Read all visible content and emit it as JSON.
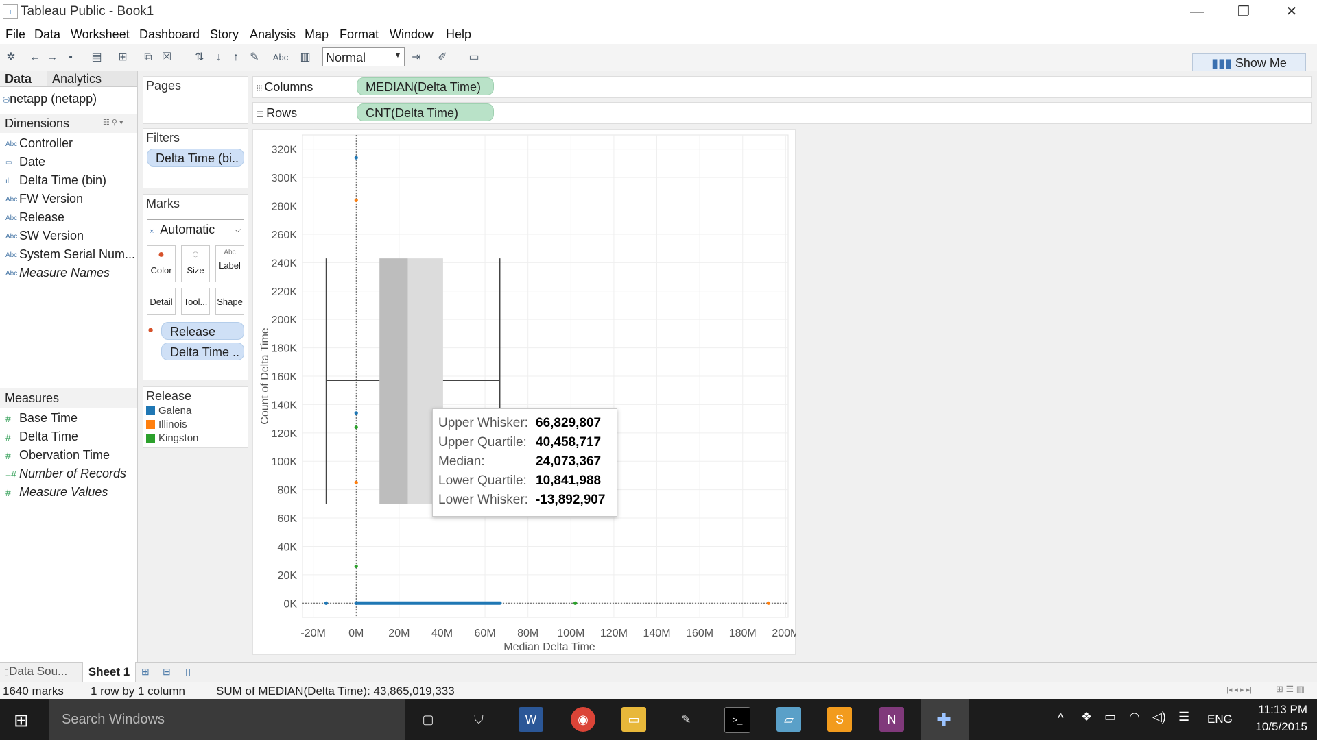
{
  "window": {
    "title": "Tableau Public - Book1",
    "minimize": "—",
    "restore": "❐",
    "close": "✕"
  },
  "menu": [
    "File",
    "Data",
    "Worksheet",
    "Dashboard",
    "Story",
    "Analysis",
    "Map",
    "Format",
    "Window",
    "Help"
  ],
  "toolbar": {
    "mark_size": "Normal",
    "show_me": "Show Me",
    "abc_label": "Abc"
  },
  "data_pane": {
    "tabs": [
      "Data",
      "Analytics"
    ],
    "datasource": "netapp (netapp)",
    "dimensions_header": "Dimensions",
    "dimensions": [
      {
        "icon": "Abc",
        "label": "Controller",
        "italic": false
      },
      {
        "icon": "▭",
        "label": "Date",
        "italic": false
      },
      {
        "icon": "ıl",
        "label": "Delta Time (bin)",
        "italic": false
      },
      {
        "icon": "Abc",
        "label": "FW Version",
        "italic": false
      },
      {
        "icon": "Abc",
        "label": "Release",
        "italic": false
      },
      {
        "icon": "Abc",
        "label": "SW Version",
        "italic": false
      },
      {
        "icon": "Abc",
        "label": "System Serial Num...",
        "italic": false
      },
      {
        "icon": "Abc",
        "label": "Measure Names",
        "italic": true
      }
    ],
    "measures_header": "Measures",
    "measures": [
      {
        "icon": "#",
        "label": "Base Time",
        "italic": false
      },
      {
        "icon": "#",
        "label": "Delta Time",
        "italic": false
      },
      {
        "icon": "#",
        "label": "Obervation Time",
        "italic": false
      },
      {
        "icon": "=#",
        "label": "Number of Records",
        "italic": true
      },
      {
        "icon": "#",
        "label": "Measure Values",
        "italic": true
      }
    ]
  },
  "cards": {
    "pages": "Pages",
    "filters": "Filters",
    "filter_pill": "Delta Time (bi..",
    "marks": "Marks",
    "mark_type": "Automatic",
    "mark_buttons": [
      "Color",
      "Size",
      "Label",
      "Detail",
      "Tool...",
      "Shape"
    ],
    "mark_pills": [
      "Release",
      "Delta Time .."
    ],
    "legend_title": "Release",
    "legend": [
      {
        "label": "Galena",
        "color": "#1f77b4"
      },
      {
        "label": "Illinois",
        "color": "#ff7f0e"
      },
      {
        "label": "Kingston",
        "color": "#2ca02c"
      }
    ]
  },
  "shelves": {
    "columns_label": "Columns",
    "columns_pill": "MEDIAN(Delta Time)",
    "rows_label": "Rows",
    "rows_pill": "CNT(Delta Time)"
  },
  "chart_data": {
    "type": "scatter",
    "xlabel": "Median Delta Time",
    "ylabel": "Count of Delta Time",
    "xlim": [
      -25000000,
      205000000
    ],
    "ylim": [
      -10000,
      330000
    ],
    "x_ticks": [
      "-20M",
      "0M",
      "20M",
      "40M",
      "60M",
      "80M",
      "100M",
      "120M",
      "140M",
      "160M",
      "180M",
      "200M"
    ],
    "x_tick_values": [
      -20000000,
      0,
      20000000,
      40000000,
      60000000,
      80000000,
      100000000,
      120000000,
      140000000,
      160000000,
      180000000,
      200000000
    ],
    "y_ticks": [
      "0K",
      "20K",
      "40K",
      "60K",
      "80K",
      "100K",
      "120K",
      "140K",
      "160K",
      "180K",
      "200K",
      "220K",
      "240K",
      "260K",
      "280K",
      "300K",
      "320K"
    ],
    "y_tick_values": [
      0,
      20000,
      40000,
      60000,
      80000,
      100000,
      120000,
      140000,
      160000,
      180000,
      200000,
      220000,
      240000,
      260000,
      280000,
      300000,
      320000
    ],
    "grid": true,
    "series": [
      {
        "name": "Galena",
        "color": "#1f77b4",
        "points": [
          [
            0,
            314000
          ],
          [
            0,
            134000
          ],
          [
            -14000000,
            0
          ],
          [
            0,
            0
          ]
        ]
      },
      {
        "name": "Illinois",
        "color": "#ff7f0e",
        "points": [
          [
            0,
            284000
          ],
          [
            0,
            85000
          ],
          [
            192000000,
            0
          ]
        ]
      },
      {
        "name": "Kingston",
        "color": "#2ca02c",
        "points": [
          [
            0,
            124000
          ],
          [
            0,
            26000
          ],
          [
            102000000,
            0
          ]
        ]
      }
    ],
    "baseline_band": {
      "x_from": 0,
      "x_to": 67000000,
      "y": 0,
      "color": "#1f77b4"
    },
    "boxplot": {
      "y_low": 70000,
      "y_high": 243000,
      "y_mid": 157000,
      "upper_whisker": 66829807,
      "upper_quartile": 40458717,
      "median": 24073367,
      "lower_quartile": 10841988,
      "lower_whisker": -13892907
    },
    "tooltip": [
      {
        "key": "Upper Whisker:",
        "value": "66,829,807"
      },
      {
        "key": "Upper Quartile:",
        "value": "40,458,717"
      },
      {
        "key": "Median:",
        "value": "24,073,367"
      },
      {
        "key": "Lower Quartile:",
        "value": "10,841,988"
      },
      {
        "key": "Lower Whisker:",
        "value": "-13,892,907"
      }
    ]
  },
  "sheet_tabs": {
    "data_source": "Data Sou...",
    "sheet": "Sheet 1"
  },
  "status": {
    "marks": "1640 marks",
    "dims": "1 row by 1 column",
    "sum": "SUM of MEDIAN(Delta Time): 43,865,019,333"
  },
  "taskbar": {
    "search": "Search Windows",
    "lang": "ENG",
    "time": "11:13 PM",
    "date": "10/5/2015"
  }
}
